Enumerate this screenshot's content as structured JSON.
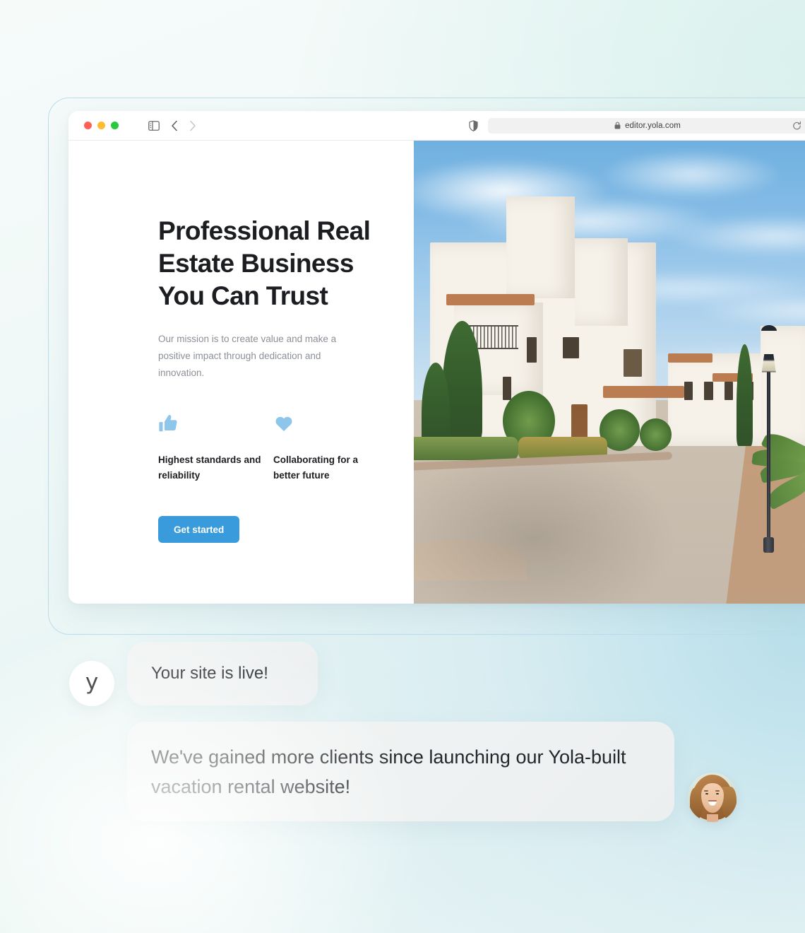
{
  "browser": {
    "traffic_lights": [
      "close",
      "minimize",
      "maximize"
    ],
    "sidebar_icon": "sidebar-toggle-icon",
    "back_icon": "chevron-left-icon",
    "forward_icon": "chevron-right-icon",
    "shield_icon": "privacy-shield-icon",
    "lock_icon": "lock-icon",
    "url": "editor.yola.com",
    "reload_icon": "reload-icon"
  },
  "site": {
    "hero": {
      "title": "Professional Real Estate Business You Can Trust",
      "subtitle": "Our mission is to create value and make a positive impact through dedication and innovation.",
      "cta_label": "Get started"
    },
    "features": [
      {
        "icon": "thumbs-up-icon",
        "label": "Highest standards and reliability"
      },
      {
        "icon": "heart-icon",
        "label": "Collaborating for a better future"
      }
    ],
    "photo_alt": "White Mediterranean villas along a paved resort street with a lamppost, palms and blue sky"
  },
  "chat": {
    "brand_logo_letter": "y",
    "messages": [
      {
        "from": "yola",
        "text": "Your site is live!"
      },
      {
        "from": "customer",
        "text": "We've gained more clients since launching our Yola-built vacation rental website!"
      }
    ],
    "customer_avatar_alt": "Smiling woman with auburn hair"
  },
  "colors": {
    "accent_blue": "#3a9bdc",
    "icon_blue": "#8ec5ea",
    "heading": "#1b1d21",
    "body_text": "#8b8f96",
    "bubble_bg": "#eff2f2",
    "frame_border": "#bcdceb"
  }
}
